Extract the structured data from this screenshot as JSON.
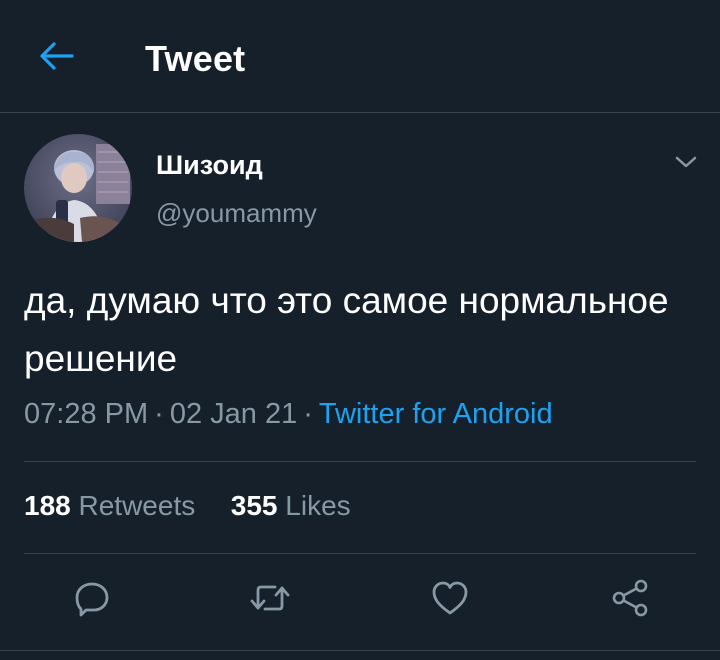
{
  "header": {
    "title": "Tweet",
    "back_icon": "arrow-left-icon"
  },
  "tweet": {
    "author": {
      "display_name": "Шизоид",
      "handle": "@youmammy"
    },
    "text": "да, думаю что это самое нормальное решение",
    "time": "07:28 PM",
    "date": "02 Jan 21",
    "separator": "·",
    "source": "Twitter for Android",
    "stats": {
      "retweets_count": "188",
      "retweets_label": "Retweets",
      "likes_count": "355",
      "likes_label": "Likes"
    },
    "actions": [
      "reply-icon",
      "retweet-icon",
      "like-icon",
      "share-icon"
    ]
  },
  "colors": {
    "background": "#15202b",
    "accent": "#1da1f2",
    "secondary_text": "#8899a6",
    "divider": "#38444d"
  }
}
